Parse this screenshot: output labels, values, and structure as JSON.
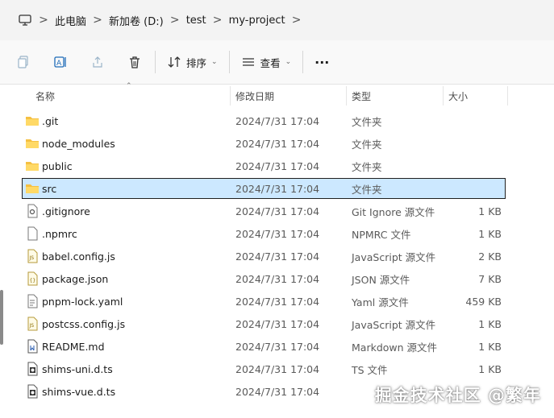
{
  "address": {
    "crumbs": [
      "此电脑",
      "新加卷 (D:)",
      "test",
      "my-project"
    ],
    "separator": ">"
  },
  "toolbar": {
    "sort_label": "排序",
    "view_label": "查看",
    "more_label": "···"
  },
  "columns": {
    "name": "名称",
    "date": "修改日期",
    "type": "类型",
    "size": "大小"
  },
  "files": [
    {
      "name": ".git",
      "date": "2024/7/31 17:04",
      "type": "文件夹",
      "size": "",
      "icon": "folder-icon"
    },
    {
      "name": "node_modules",
      "date": "2024/7/31 17:04",
      "type": "文件夹",
      "size": "",
      "icon": "folder-icon"
    },
    {
      "name": "public",
      "date": "2024/7/31 17:04",
      "type": "文件夹",
      "size": "",
      "icon": "folder-icon"
    },
    {
      "name": "src",
      "date": "2024/7/31 17:04",
      "type": "文件夹",
      "size": "",
      "icon": "folder-icon",
      "selected": true
    },
    {
      "name": ".gitignore",
      "date": "2024/7/31 17:04",
      "type": "Git Ignore 源文件",
      "size": "1 KB",
      "icon": "config-file-icon"
    },
    {
      "name": ".npmrc",
      "date": "2024/7/31 17:04",
      "type": "NPMRC 文件",
      "size": "1 KB",
      "icon": "blank-file-icon"
    },
    {
      "name": "babel.config.js",
      "date": "2024/7/31 17:04",
      "type": "JavaScript 源文件",
      "size": "2 KB",
      "icon": "js-file-icon"
    },
    {
      "name": "package.json",
      "date": "2024/7/31 17:04",
      "type": "JSON 源文件",
      "size": "7 KB",
      "icon": "json-file-icon"
    },
    {
      "name": "pnpm-lock.yaml",
      "date": "2024/7/31 17:04",
      "type": "Yaml 源文件",
      "size": "459 KB",
      "icon": "text-file-icon"
    },
    {
      "name": "postcss.config.js",
      "date": "2024/7/31 17:04",
      "type": "JavaScript 源文件",
      "size": "1 KB",
      "icon": "js-file-icon"
    },
    {
      "name": "README.md",
      "date": "2024/7/31 17:04",
      "type": "Markdown 源文件",
      "size": "1 KB",
      "icon": "markdown-file-icon"
    },
    {
      "name": "shims-uni.d.ts",
      "date": "2024/7/31 17:04",
      "type": "TS 文件",
      "size": "1 KB",
      "icon": "ts-file-icon"
    },
    {
      "name": "shims-vue.d.ts",
      "date": "2024/7/31 17:04",
      "type": "",
      "size": "",
      "icon": "ts-file-icon"
    }
  ],
  "watermark": "掘金技术社区 @繁年"
}
